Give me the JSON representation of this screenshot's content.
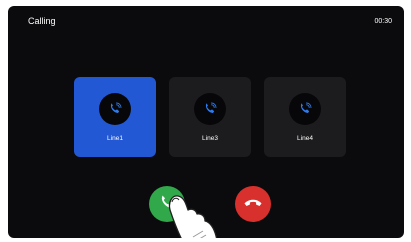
{
  "header": {
    "title": "Calling",
    "timer": "00:30"
  },
  "lines": [
    {
      "label": "Line1",
      "active": true,
      "icon": "phone-ringing-icon"
    },
    {
      "label": "Line3",
      "active": false,
      "icon": "phone-ringing-icon"
    },
    {
      "label": "Line4",
      "active": false,
      "icon": "phone-ringing-icon"
    }
  ],
  "actions": {
    "answer_icon": "phone-answer-icon",
    "hangup_icon": "phone-hangup-icon"
  },
  "colors": {
    "background": "#0b0b0d",
    "card": "#1c1c1e",
    "card_active": "#2358d4",
    "answer": "#31a84a",
    "hangup": "#d8302c",
    "icon_blue": "#2e7bf0"
  }
}
